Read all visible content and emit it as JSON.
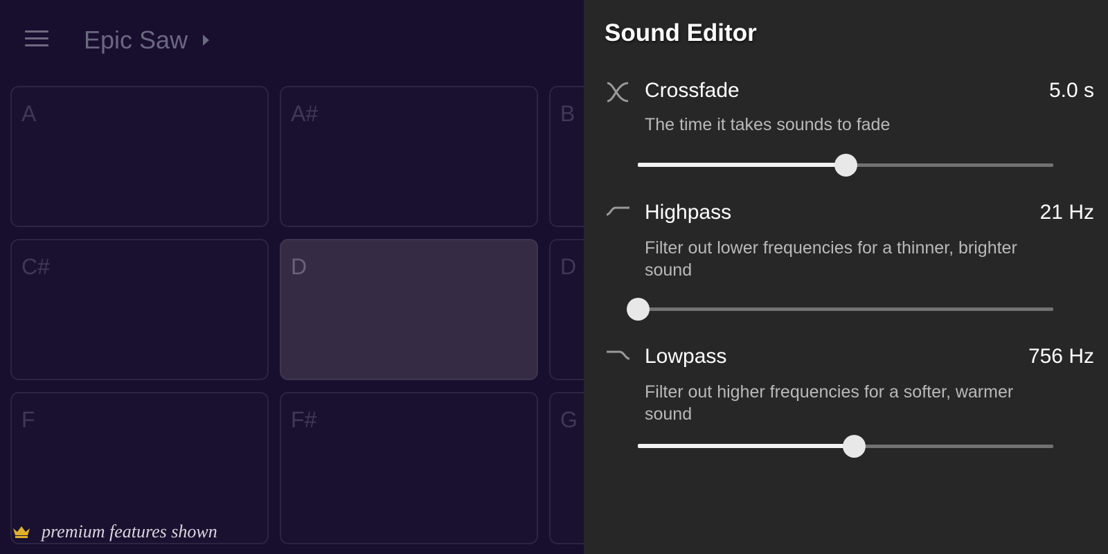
{
  "header": {
    "preset_name": "Epic Saw"
  },
  "pads": [
    {
      "label": "A"
    },
    {
      "label": "A#"
    },
    {
      "label": "B"
    },
    {
      "label": "C#"
    },
    {
      "label": "D"
    },
    {
      "label": "D"
    },
    {
      "label": "F"
    },
    {
      "label": "F#"
    },
    {
      "label": "G"
    }
  ],
  "active_pad": "D",
  "footer": {
    "premium_text": "premium features shown",
    "crown_color": "#e0b12a"
  },
  "editor": {
    "title": "Sound Editor",
    "settings": [
      {
        "icon": "crossfade-icon",
        "name": "Crossfade",
        "value": "5.0 s",
        "description": "The time it takes sounds to fade",
        "level": 0.5
      },
      {
        "icon": "highpass-icon",
        "name": "Highpass",
        "value": "21 Hz",
        "description": "Filter out lower frequencies for a thinner, brighter sound",
        "level": 0.0
      },
      {
        "icon": "lowpass-icon",
        "name": "Lowpass",
        "value": "756 Hz",
        "description": "Filter out higher frequencies for a softer, warmer sound",
        "level": 0.52
      }
    ]
  },
  "colors": {
    "pad_background": "#1a1130",
    "editor_background": "#272727",
    "active_pad": "#352b45"
  }
}
